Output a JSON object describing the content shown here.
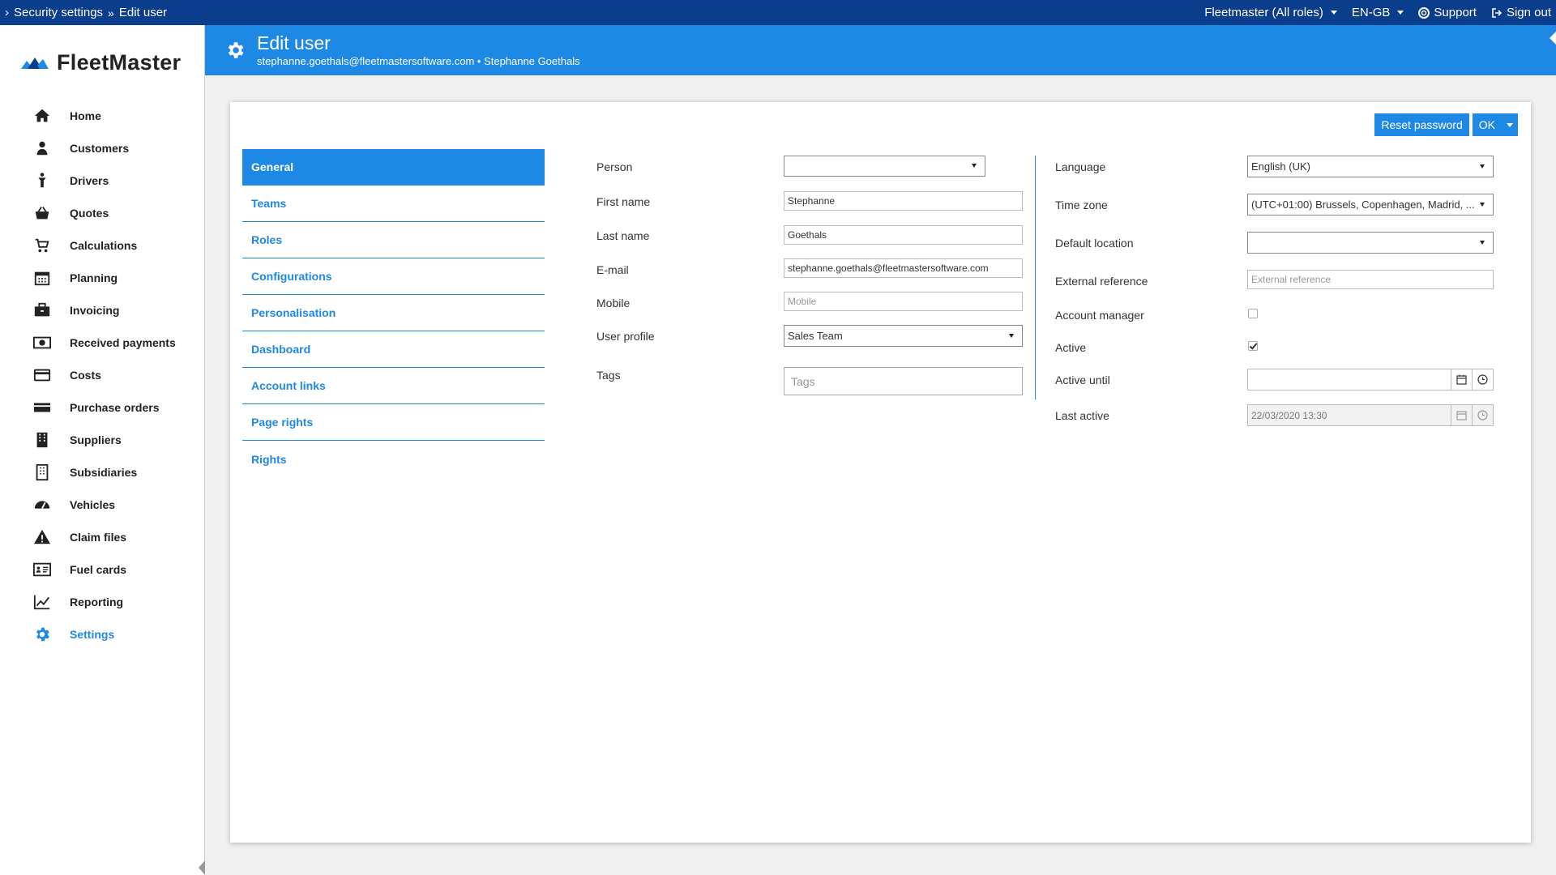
{
  "topbar": {
    "breadcrumb": [
      "Security settings",
      "Edit user"
    ],
    "role": "Fleetmaster (All roles)",
    "language": "EN-GB",
    "support": "Support",
    "signout": "Sign out"
  },
  "brand": {
    "name": "FleetMaster",
    "accent": "#1e88e5",
    "topbar_color": "#0a3d8c"
  },
  "nav": [
    {
      "label": "Home",
      "icon": "home-icon"
    },
    {
      "label": "Customers",
      "icon": "person-icon"
    },
    {
      "label": "Drivers",
      "icon": "driver-icon"
    },
    {
      "label": "Quotes",
      "icon": "basket-icon"
    },
    {
      "label": "Calculations",
      "icon": "cart-icon"
    },
    {
      "label": "Planning",
      "icon": "calendar-icon"
    },
    {
      "label": "Invoicing",
      "icon": "briefcase-icon"
    },
    {
      "label": "Received payments",
      "icon": "money-icon"
    },
    {
      "label": "Costs",
      "icon": "credit-card-icon"
    },
    {
      "label": "Purchase orders",
      "icon": "card-icon"
    },
    {
      "label": "Suppliers",
      "icon": "building-icon"
    },
    {
      "label": "Subsidiaries",
      "icon": "building-outline-icon"
    },
    {
      "label": "Vehicles",
      "icon": "dashboard-gauge-icon"
    },
    {
      "label": "Claim files",
      "icon": "warning-icon"
    },
    {
      "label": "Fuel cards",
      "icon": "id-card-icon"
    },
    {
      "label": "Reporting",
      "icon": "chart-line-icon"
    },
    {
      "label": "Settings",
      "icon": "gear-icon",
      "active": true
    }
  ],
  "header": {
    "title": "Edit user",
    "subtitle": "stephanne.goethals@fleetmastersoftware.com • Stephanne Goethals"
  },
  "actions": {
    "reset_password": "Reset password",
    "ok": "OK"
  },
  "tabs": [
    "General",
    "Teams",
    "Roles",
    "Configurations",
    "Personalisation",
    "Dashboard",
    "Account links",
    "Page rights",
    "Rights"
  ],
  "form_left": {
    "person": {
      "label": "Person",
      "value": ""
    },
    "first_name": {
      "label": "First name",
      "value": "Stephanne"
    },
    "last_name": {
      "label": "Last name",
      "value": "Goethals"
    },
    "email": {
      "label": "E-mail",
      "value": "stephanne.goethals@fleetmastersoftware.com"
    },
    "mobile": {
      "label": "Mobile",
      "placeholder": "Mobile"
    },
    "user_profile": {
      "label": "User profile",
      "value": "Sales Team"
    },
    "tags": {
      "label": "Tags",
      "placeholder": "Tags"
    }
  },
  "form_right": {
    "language": {
      "label": "Language",
      "value": "English (UK)"
    },
    "time_zone": {
      "label": "Time zone",
      "value": "(UTC+01:00) Brussels, Copenhagen, Madrid, ..."
    },
    "default_location": {
      "label": "Default location",
      "value": ""
    },
    "external_reference": {
      "label": "External reference",
      "placeholder": "External reference"
    },
    "account_manager": {
      "label": "Account manager",
      "checked": false
    },
    "active": {
      "label": "Active",
      "checked": true
    },
    "active_until": {
      "label": "Active until",
      "value": ""
    },
    "last_active": {
      "label": "Last active",
      "value": "22/03/2020 13:30"
    }
  }
}
